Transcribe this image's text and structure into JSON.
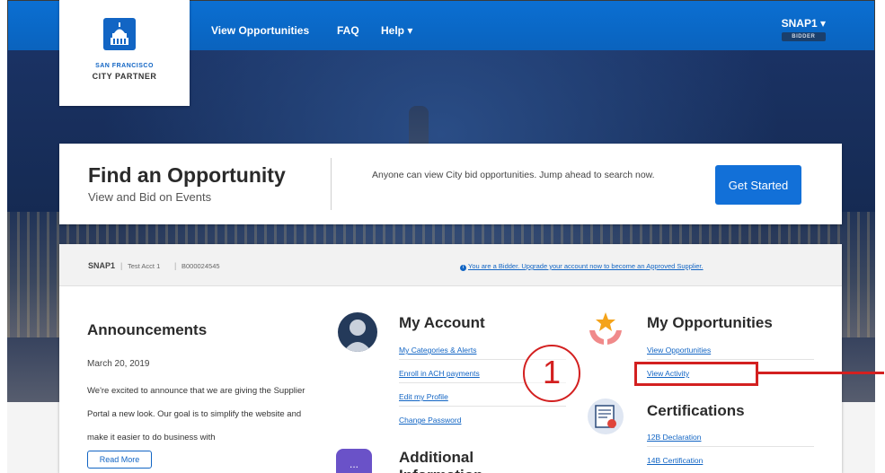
{
  "header": {
    "nav": [
      "View Opportunities",
      "FAQ",
      "Help ▾"
    ],
    "user": "SNAP1 ▾",
    "role": "BIDDER"
  },
  "logo": {
    "line1": "SAN FRANCISCO",
    "line2": "CITY PARTNER"
  },
  "find": {
    "title": "Find an Opportunity",
    "subtitle": "View and Bid on Events",
    "description": "Anyone can view City bid opportunities. Jump ahead to search now.",
    "button": "Get Started"
  },
  "account_bar": {
    "user": "SNAP1",
    "account_name": "Test Acct 1",
    "account_id": "B000024545",
    "upgrade_text": "You are a Bidder. Upgrade your account now to become an Approved Supplier."
  },
  "announcements": {
    "title": "Announcements",
    "date": "March 20, 2019",
    "body": "We're excited to announce that we are giving the Supplier Portal a new look. Our goal is to simplify the website and make it easier to do business with",
    "read_more": "Read More"
  },
  "my_account": {
    "title": "My Account",
    "links": [
      "My Categories & Alerts",
      "Enroll in ACH payments",
      "Edit my Profile",
      "Change Password"
    ]
  },
  "additional": {
    "title": "Additional Information",
    "icon_text": "..."
  },
  "my_opportunities": {
    "title": "My Opportunities",
    "links": [
      "View Opportunities",
      "View Activity"
    ]
  },
  "certifications": {
    "title": "Certifications",
    "links": [
      "12B Declaration",
      "14B Certification"
    ]
  },
  "annotation": {
    "step": "1",
    "color": "#d32020"
  },
  "colors": {
    "brand_blue": "#1265c4",
    "nav_blue": "#0b6fd2"
  }
}
